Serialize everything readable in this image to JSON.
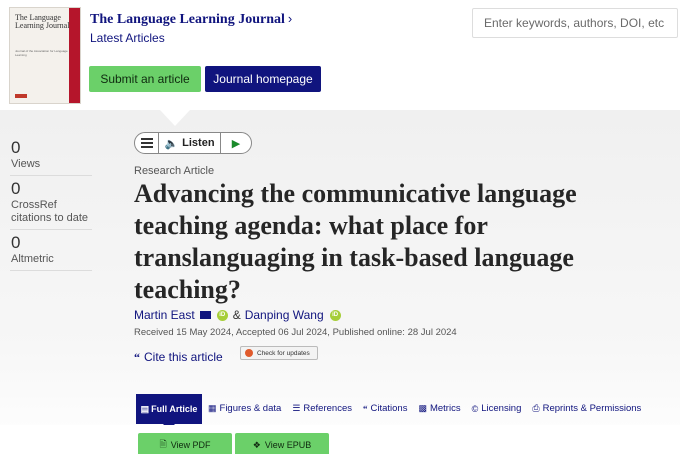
{
  "header": {
    "cover": {
      "title": "The Language Learning Journal",
      "subtitle": "Journal of the Association for Language Learning"
    },
    "journal_title": "The Language Learning Journal",
    "journal_title_chevron": "›",
    "latest_articles": "Latest Articles",
    "submit_label": "Submit an article",
    "homepage_label": "Journal homepage",
    "search_placeholder": "Enter keywords, authors, DOI, etc"
  },
  "metrics": [
    {
      "value": "0",
      "label": "Views"
    },
    {
      "value": "0",
      "label": "CrossRef citations to date"
    },
    {
      "value": "0",
      "label": "Altmetric"
    }
  ],
  "listen": {
    "label": "Listen",
    "speaker_icon": "speaker-icon",
    "play_icon": "play-icon"
  },
  "article": {
    "type": "Research Article",
    "title": "Advancing the communicative language teaching agenda: what place for translanguaging in task-based language teaching?",
    "authors": [
      {
        "name": "Martin East",
        "email_icon": true,
        "orcid": true
      },
      {
        "name": "Danping Wang",
        "email_icon": false,
        "orcid": true
      }
    ],
    "author_separator": "&",
    "orcid_text": "iD",
    "dates": "Received 15 May 2024, Accepted 06 Jul 2024, Published online: 28 Jul 2024",
    "cite_label": "Cite this article",
    "check_updates_label": "Check for updates"
  },
  "tabs": {
    "active": {
      "label": "Full Article",
      "icon": "document-icon"
    },
    "items": [
      {
        "label": "Figures & data",
        "icon": "image-icon"
      },
      {
        "label": "References",
        "icon": "list-icon"
      },
      {
        "label": "Citations",
        "icon": "quote-icon"
      },
      {
        "label": "Metrics",
        "icon": "bar-chart-icon"
      },
      {
        "label": "Licensing",
        "icon": "copyright-icon"
      },
      {
        "label": "Reprints & Permissions",
        "icon": "print-icon"
      }
    ]
  },
  "actions": {
    "pdf_label": "View PDF",
    "epub_label": "View EPUB"
  },
  "colors": {
    "brand_navy": "#10147e",
    "green": "#6bd069",
    "cover_red": "#b5152b"
  }
}
